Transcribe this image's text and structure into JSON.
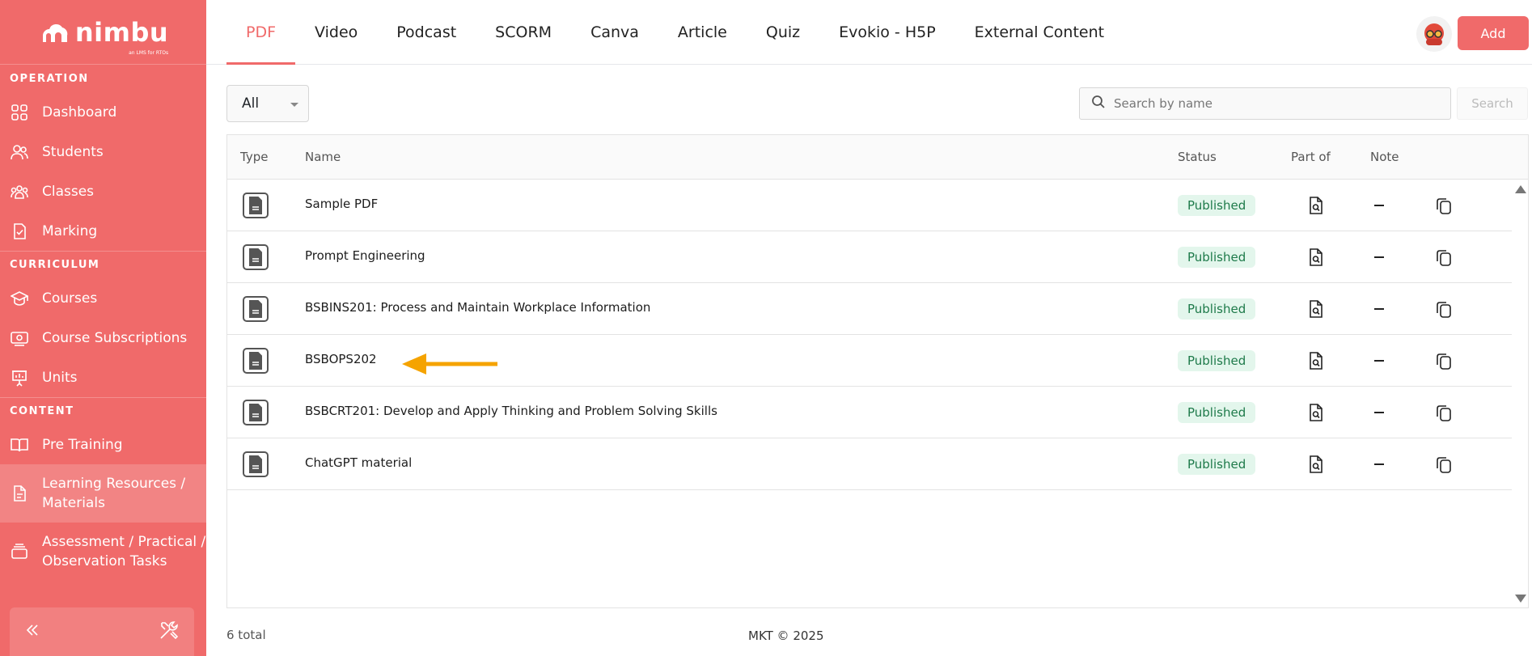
{
  "app": {
    "name": "nimbu",
    "tagline": "an LMS for RTOs"
  },
  "sidebar": {
    "sections": [
      {
        "title": "OPERATION",
        "items": [
          {
            "label": "Dashboard",
            "icon": "dashboard-icon"
          },
          {
            "label": "Students",
            "icon": "students-icon"
          },
          {
            "label": "Classes",
            "icon": "classes-icon"
          },
          {
            "label": "Marking",
            "icon": "marking-icon"
          }
        ]
      },
      {
        "title": "CURRICULUM",
        "items": [
          {
            "label": "Courses",
            "icon": "graduation-cap-icon"
          },
          {
            "label": "Course Subscriptions",
            "icon": "subscriptions-icon"
          },
          {
            "label": "Units",
            "icon": "presentation-icon"
          }
        ]
      },
      {
        "title": "CONTENT",
        "items": [
          {
            "label": "Pre Training",
            "icon": "book-icon"
          },
          {
            "label": "Learning Resources / Materials",
            "icon": "document-icon",
            "active": true
          },
          {
            "label": "Assessment / Practical / Observation Tasks",
            "icon": "tray-icon"
          }
        ]
      }
    ],
    "collapse_icon": "double-chevron-left-icon",
    "tools_icon": "tools-icon"
  },
  "tabs": [
    {
      "label": "PDF",
      "active": true
    },
    {
      "label": "Video"
    },
    {
      "label": "Podcast"
    },
    {
      "label": "SCORM"
    },
    {
      "label": "Canva"
    },
    {
      "label": "Article"
    },
    {
      "label": "Quiz"
    },
    {
      "label": "Evokio - H5P"
    },
    {
      "label": "External Content"
    }
  ],
  "header": {
    "add_label": "Add"
  },
  "filter": {
    "selected": "All"
  },
  "search": {
    "placeholder": "Search by name",
    "button_label": "Search"
  },
  "table": {
    "columns": {
      "type": "Type",
      "name": "Name",
      "status": "Status",
      "part_of": "Part of",
      "note": "Note"
    },
    "rows": [
      {
        "name": "Sample PDF",
        "status": "Published"
      },
      {
        "name": "Prompt Engineering",
        "status": "Published"
      },
      {
        "name": "BSBINS201: Process and Maintain Workplace Information",
        "status": "Published"
      },
      {
        "name": "BSBOPS202",
        "status": "Published"
      },
      {
        "name": "BSBCRT201: Develop and Apply Thinking and Problem Solving Skills",
        "status": "Published"
      },
      {
        "name": "ChatGPT material",
        "status": "Published"
      }
    ]
  },
  "footer": {
    "total": "6 total",
    "copyright": "MKT © 2025"
  },
  "colors": {
    "brand": "#f06a6a",
    "published_bg": "#e3f6ec",
    "published_text": "#1e7a4a",
    "annotation_arrow": "#f5a300"
  }
}
